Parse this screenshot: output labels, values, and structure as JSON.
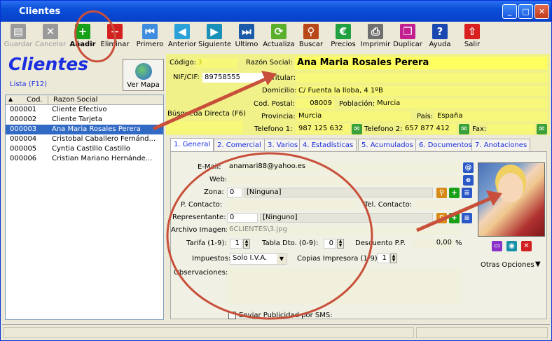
{
  "window": {
    "title": "Clientes"
  },
  "toolbar": [
    {
      "label": "Guardar",
      "icon": "save-icon",
      "color": "#9a9a9a",
      "glyph": "▤",
      "disabled": true
    },
    {
      "label": "Cancelar",
      "icon": "cancel-icon",
      "color": "#9a9a9a",
      "glyph": "✕",
      "disabled": true
    },
    {
      "label": "Añadir",
      "icon": "add-icon",
      "color": "#18a018",
      "glyph": "+",
      "disabled": false
    },
    {
      "label": "Eliminar",
      "icon": "delete-icon",
      "color": "#d22020",
      "glyph": "−",
      "disabled": false
    },
    {
      "label": "Primero",
      "icon": "first-icon",
      "color": "#3d8ce0",
      "glyph": "⏮",
      "disabled": false
    },
    {
      "label": "Anterior",
      "icon": "previous-icon",
      "color": "#28a0d8",
      "glyph": "◀",
      "disabled": false
    },
    {
      "label": "Siguiente",
      "icon": "next-icon",
      "color": "#1890b8",
      "glyph": "▶",
      "disabled": false
    },
    {
      "label": "Ultimo",
      "icon": "last-icon",
      "color": "#1a5aa8",
      "glyph": "⏭",
      "disabled": false
    },
    {
      "label": "Actualiza",
      "icon": "refresh-icon",
      "color": "#5ab02a",
      "glyph": "⟳",
      "disabled": false
    },
    {
      "label": "Buscar",
      "icon": "binoculars-icon",
      "color": "#b84818",
      "glyph": "⚲",
      "disabled": false
    },
    {
      "label": "Precios",
      "icon": "euro-icon",
      "color": "#20a040",
      "glyph": "€",
      "disabled": false
    },
    {
      "label": "Imprimir",
      "icon": "printer-icon",
      "color": "#707070",
      "glyph": "⎙",
      "disabled": false
    },
    {
      "label": "Duplicar",
      "icon": "duplicate-icon",
      "color": "#c02090",
      "glyph": "❐",
      "disabled": false
    },
    {
      "label": "Ayuda",
      "icon": "help-icon",
      "color": "#1848b0",
      "glyph": "?",
      "disabled": false
    },
    {
      "label": "Salir",
      "icon": "exit-icon",
      "color": "#d82020",
      "glyph": "⇧",
      "disabled": false
    }
  ],
  "left": {
    "title": "Clientes",
    "map_button": "Ver Mapa",
    "list_label": "Lista (F12)",
    "columns": [
      "Cod.",
      "Razon Social"
    ],
    "rows": [
      {
        "code": "000001",
        "name": "Cliente Efectivo",
        "selected": false
      },
      {
        "code": "000002",
        "name": "Cliente Tarjeta",
        "selected": false
      },
      {
        "code": "000003",
        "name": "Ana Maria Rosales Perera",
        "selected": true
      },
      {
        "code": "000004",
        "name": "Cristobal Caballero Fernánd...",
        "selected": false
      },
      {
        "code": "000005",
        "name": "Cyntia Castillo Castillo",
        "selected": false
      },
      {
        "code": "000006",
        "name": "Cristian Mariano Hernánde...",
        "selected": false
      }
    ]
  },
  "header": {
    "codigo_label": "Código:",
    "codigo": "3",
    "razon_label": "Razón Social:",
    "razon": "Ana Maria Rosales Perera",
    "nif_label": "NIF/CIF:",
    "nif": "89758555",
    "titular_label": "Titular:",
    "titular": "",
    "domicilio_label": "Domicilio:",
    "domicilio": "C/ Fuenta la lloba, 4 1ºB",
    "cp_label": "Cod. Postal:",
    "cp": "08009",
    "poblacion_label": "Población:",
    "poblacion": "Murcia",
    "busqueda_label": "Búsqueda Directa (F6)",
    "provincia_label": "Provincia:",
    "provincia": "Murcia",
    "pais_label": "País:",
    "pais": "España",
    "tel1_label": "Telefono 1:",
    "tel1": "987 125 632",
    "tel2_label": "Telefono 2:",
    "tel2": "657 877 412",
    "fax_label": "Fax:",
    "fax": ""
  },
  "tabs": [
    "1. General",
    "2. Comercial",
    "3. Varios",
    "4. Estadísticas",
    "5. Acumulados",
    "6. Documentos",
    "7. Anotaciones"
  ],
  "general": {
    "email_label": "E-Mail:",
    "email": "anamari88@yahoo.es",
    "web_label": "Web:",
    "web": "",
    "zona_label": "Zona:",
    "zona_code": "0",
    "zona_name": "[Ninguna]",
    "contacto_label": "P. Contacto:",
    "contacto": "",
    "tel_contacto_label": "Tel. Contacto:",
    "tel_contacto": "",
    "rep_label": "Representante:",
    "rep_code": "0",
    "rep_name": "[Ninguno]",
    "imagen_label": "Archivo Imagen:",
    "imagen": "6CLIENTES\\3.jpg",
    "tarifa_label": "Tarifa (1-9):",
    "tarifa": "1",
    "tabla_label": "Tabla Dto. (0-9):",
    "tabla": "0",
    "descuento_label": "Descuento P.P.",
    "descuento": "0,00",
    "descuento_unit": "%",
    "impuestos_label": "Impuestos:",
    "impuestos": "Solo I.V.A.",
    "copias_label": "Copias Impresora (1-9):",
    "copias": "1",
    "obs_label": "Observaciones:",
    "obs": "",
    "sms_label": "Enviar Publicidad por SMS:",
    "otras": "Otras Opciones"
  }
}
